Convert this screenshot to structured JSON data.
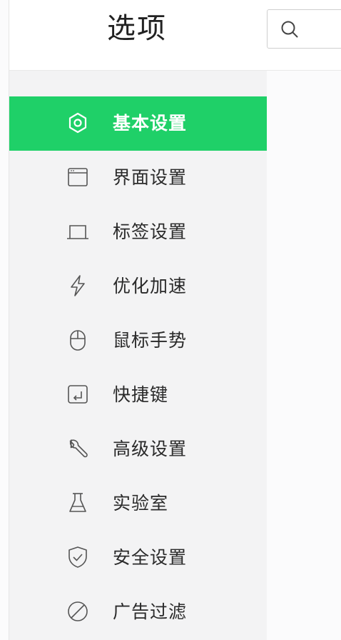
{
  "header": {
    "title": "选项",
    "search_placeholder": ""
  },
  "sidebar": {
    "active_color": "#1fd068",
    "items": [
      {
        "label": "基本设置",
        "icon": "hexagon-gear-icon",
        "active": true
      },
      {
        "label": "界面设置",
        "icon": "window-icon",
        "active": false
      },
      {
        "label": "标签设置",
        "icon": "tab-icon",
        "active": false
      },
      {
        "label": "优化加速",
        "icon": "lightning-icon",
        "active": false
      },
      {
        "label": "鼠标手势",
        "icon": "mouse-icon",
        "active": false
      },
      {
        "label": "快捷键",
        "icon": "keyboard-key-icon",
        "active": false
      },
      {
        "label": "高级设置",
        "icon": "wrench-icon",
        "active": false
      },
      {
        "label": "实验室",
        "icon": "flask-icon",
        "active": false
      },
      {
        "label": "安全设置",
        "icon": "shield-check-icon",
        "active": false
      },
      {
        "label": "广告过滤",
        "icon": "block-icon",
        "active": false
      }
    ]
  }
}
